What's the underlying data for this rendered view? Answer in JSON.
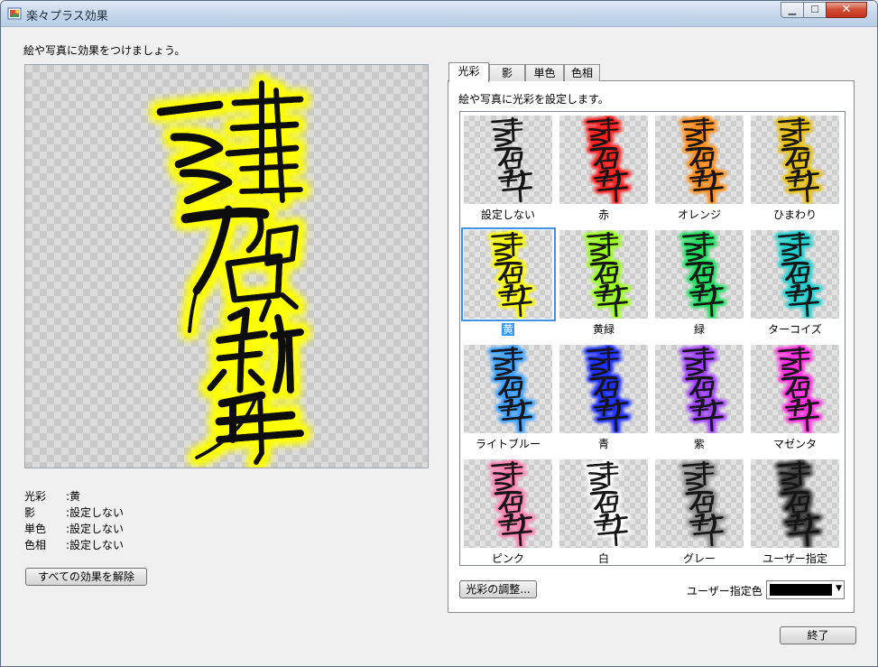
{
  "window": {
    "title": "楽々プラス効果",
    "min_glyph": "▁",
    "max_glyph": "☐",
    "close_glyph": "✕"
  },
  "instruction": "絵や写真に効果をつけましょう。",
  "preview": {
    "glow_color": "#ffff00"
  },
  "status": [
    {
      "key": "光彩",
      "value": ":黄"
    },
    {
      "key": "影",
      "value": ":設定しない"
    },
    {
      "key": "単色",
      "value": ":設定しない"
    },
    {
      "key": "色相",
      "value": ":設定しない"
    }
  ],
  "reset_button": "すべての効果を解除",
  "tabs": [
    "光彩",
    "影",
    "単色",
    "色相"
  ],
  "active_tab": "光彩",
  "panel_desc": "絵や写真に光彩を設定します。",
  "gallery": [
    {
      "label": "設定しない",
      "color": ""
    },
    {
      "label": "赤",
      "color": "#ff2020"
    },
    {
      "label": "オレンジ",
      "color": "#ff8c1a"
    },
    {
      "label": "ひまわり",
      "color": "#e8c010"
    },
    {
      "label": "黄",
      "color": "#ffff00",
      "selected": true
    },
    {
      "label": "黄緑",
      "color": "#9aff20"
    },
    {
      "label": "緑",
      "color": "#20e060"
    },
    {
      "label": "ターコイズ",
      "color": "#20d0d0"
    },
    {
      "label": "ライトブルー",
      "color": "#3aa0ff"
    },
    {
      "label": "青",
      "color": "#2030ff"
    },
    {
      "label": "紫",
      "color": "#a040ff"
    },
    {
      "label": "マゼンタ",
      "color": "#ff30e0"
    },
    {
      "label": "ピンク",
      "color": "#ff80b0"
    },
    {
      "label": "白",
      "color": "#ffffff"
    },
    {
      "label": "グレー",
      "color": "#909090"
    },
    {
      "label": "ユーザー指定",
      "color": "#404040"
    }
  ],
  "adjust_button": "光彩の調整...",
  "user_color_label": "ユーザー指定色",
  "user_color_value": "#000000",
  "end_button": "終了"
}
